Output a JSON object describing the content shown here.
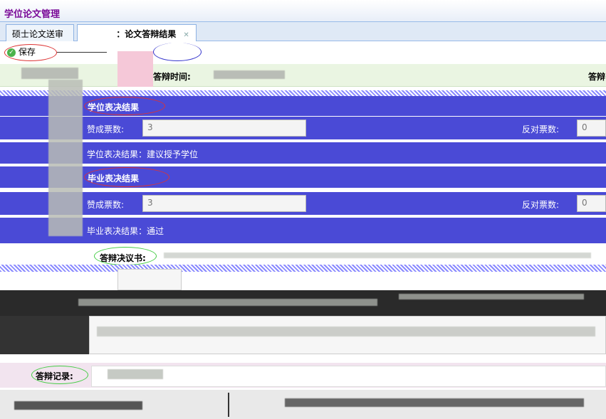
{
  "app": {
    "title": "学位论文管理"
  },
  "tabs": [
    {
      "label": "硕士论文送审"
    },
    {
      "label": "：论文答辩结果"
    }
  ],
  "toolbar": {
    "save_label": "保存"
  },
  "info": {
    "defense_time_label": "答辩时间:",
    "right_label": "答辩"
  },
  "sections": {
    "degree": {
      "title": "学位表决结果",
      "approve_label": "赞成票数:",
      "approve_value": "3",
      "against_label": "反对票数:",
      "against_value": "0",
      "result_text": "学位表决结果：建议授予学位"
    },
    "graduation": {
      "title": "毕业表决结果",
      "approve_label": "赞成票数:",
      "approve_value": "3",
      "against_label": "反对票数:",
      "against_value": "0",
      "result_text": "毕业表决结果：通过"
    }
  },
  "resolution": {
    "label": "答辩决议书:"
  },
  "record": {
    "label": "答辩记录:"
  },
  "colors": {
    "band": "#4a4ad6",
    "title": "#7a0a98",
    "oval_red": "#d33",
    "oval_green": "#4c4"
  }
}
